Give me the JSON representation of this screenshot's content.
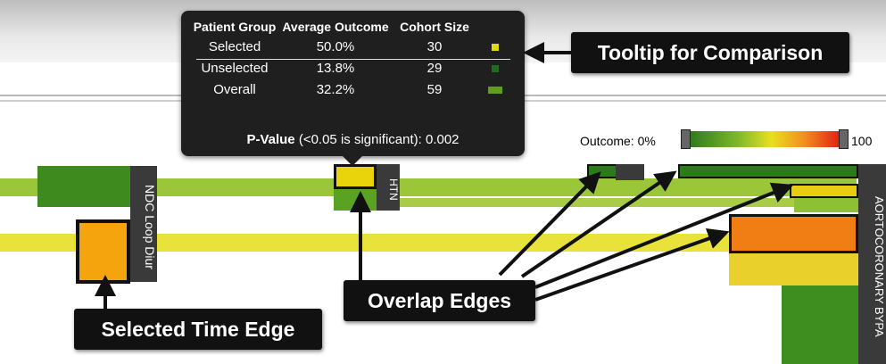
{
  "tooltip": {
    "headers": [
      "Patient Group",
      "Average Outcome",
      "Cohort Size"
    ],
    "rows": [
      {
        "group": "Selected",
        "outcome": "50.0%",
        "size": "30",
        "color": "#e4d81a"
      },
      {
        "group": "Unselected",
        "outcome": "13.8%",
        "size": "29",
        "color": "#1e6e1e"
      },
      {
        "group": "Overall",
        "outcome": "32.2%",
        "size": "59",
        "color": "#5e9e1c"
      }
    ],
    "pvalue_label": "P-Value",
    "pvalue_note": "(<0.05 is significant):",
    "pvalue": "0.002"
  },
  "legend": {
    "label": "Outcome: 0%",
    "end_label": "100",
    "colors": [
      "#1f6f1f",
      "#7fb82a",
      "#e8e020",
      "#f29020",
      "#e01010"
    ]
  },
  "labels": {
    "ndc": "NDC Loop Diur",
    "htn": "HTN",
    "aorto": "AORTOCORONARY BYPA"
  },
  "callouts": {
    "tooltip": "Tooltip for Comparison",
    "overlap": "Overlap Edges",
    "selected_time": "Selected Time Edge"
  }
}
